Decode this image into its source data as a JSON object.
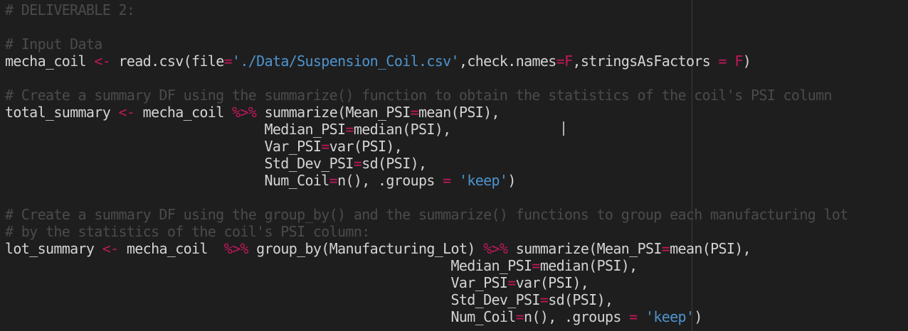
{
  "editor": {
    "lines": [
      [
        {
          "t": "# DELIVERABLE 2:",
          "c": "comment"
        }
      ],
      [],
      [
        {
          "t": "# Input Data",
          "c": "comment"
        }
      ],
      [
        {
          "t": "mecha_coil ",
          "c": "plain"
        },
        {
          "t": "<-",
          "c": "op"
        },
        {
          "t": " read.csv(file",
          "c": "plain"
        },
        {
          "t": "=",
          "c": "op"
        },
        {
          "t": "'./Data/Suspension_Coil.csv'",
          "c": "str"
        },
        {
          "t": ",check.names",
          "c": "plain"
        },
        {
          "t": "=",
          "c": "op"
        },
        {
          "t": "F",
          "c": "bool"
        },
        {
          "t": ",stringsAsFactors ",
          "c": "plain"
        },
        {
          "t": "=",
          "c": "op"
        },
        {
          "t": " ",
          "c": "plain"
        },
        {
          "t": "F",
          "c": "bool"
        },
        {
          "t": ")",
          "c": "plain"
        }
      ],
      [],
      [
        {
          "t": "# Create a summary DF using the summarize() function to obtain the statistics of the coil's PSI column",
          "c": "comment"
        }
      ],
      [
        {
          "t": "total_summary ",
          "c": "plain"
        },
        {
          "t": "<-",
          "c": "op"
        },
        {
          "t": " mecha_coil ",
          "c": "plain"
        },
        {
          "t": "%>%",
          "c": "op"
        },
        {
          "t": " summarize(Mean_PSI",
          "c": "plain"
        },
        {
          "t": "=",
          "c": "op"
        },
        {
          "t": "mean(PSI),",
          "c": "plain"
        }
      ],
      [
        {
          "t": "                                Median_PSI",
          "c": "plain"
        },
        {
          "t": "=",
          "c": "op"
        },
        {
          "t": "median(PSI),",
          "c": "plain"
        }
      ],
      [
        {
          "t": "                                Var_PSI",
          "c": "plain"
        },
        {
          "t": "=",
          "c": "op"
        },
        {
          "t": "var(PSI),",
          "c": "plain"
        }
      ],
      [
        {
          "t": "                                Std_Dev_PSI",
          "c": "plain"
        },
        {
          "t": "=",
          "c": "op"
        },
        {
          "t": "sd(PSI),",
          "c": "plain"
        }
      ],
      [
        {
          "t": "                                Num_Coil",
          "c": "plain"
        },
        {
          "t": "=",
          "c": "op"
        },
        {
          "t": "n(), .groups ",
          "c": "plain"
        },
        {
          "t": "=",
          "c": "op"
        },
        {
          "t": " ",
          "c": "plain"
        },
        {
          "t": "'keep'",
          "c": "str"
        },
        {
          "t": ")",
          "c": "plain"
        }
      ],
      [],
      [
        {
          "t": "# Create a summary DF using the group_by() and the summarize() functions to group each manufacturing lot",
          "c": "comment"
        }
      ],
      [
        {
          "t": "# by the statistics of the coil's PSI column:",
          "c": "comment"
        }
      ],
      [
        {
          "t": "lot_summary ",
          "c": "plain"
        },
        {
          "t": "<-",
          "c": "op"
        },
        {
          "t": " mecha_coil  ",
          "c": "plain"
        },
        {
          "t": "%>%",
          "c": "op"
        },
        {
          "t": " group_by(Manufacturing_Lot) ",
          "c": "plain"
        },
        {
          "t": "%>%",
          "c": "op"
        },
        {
          "t": " summarize(Mean_PSI",
          "c": "plain"
        },
        {
          "t": "=",
          "c": "op"
        },
        {
          "t": "mean(PSI),",
          "c": "plain"
        }
      ],
      [
        {
          "t": "                                                       Median_PSI",
          "c": "plain"
        },
        {
          "t": "=",
          "c": "op"
        },
        {
          "t": "median(PSI),",
          "c": "plain"
        }
      ],
      [
        {
          "t": "                                                       Var_PSI",
          "c": "plain"
        },
        {
          "t": "=",
          "c": "op"
        },
        {
          "t": "var(PSI),",
          "c": "plain"
        }
      ],
      [
        {
          "t": "                                                       Std_Dev_PSI",
          "c": "plain"
        },
        {
          "t": "=",
          "c": "op"
        },
        {
          "t": "sd(PSI),",
          "c": "plain"
        }
      ],
      [
        {
          "t": "                                                       Num_Coil",
          "c": "plain"
        },
        {
          "t": "=",
          "c": "op"
        },
        {
          "t": "n(), .groups ",
          "c": "plain"
        },
        {
          "t": "=",
          "c": "op"
        },
        {
          "t": " ",
          "c": "plain"
        },
        {
          "t": "'keep'",
          "c": "str"
        },
        {
          "t": ")",
          "c": "plain"
        }
      ]
    ]
  },
  "colors": {
    "background": "#1e1e1e",
    "text": "#d4d4d4",
    "comment": "#4b4b4b",
    "operator": "#c2185b",
    "string": "#4e94ce"
  }
}
